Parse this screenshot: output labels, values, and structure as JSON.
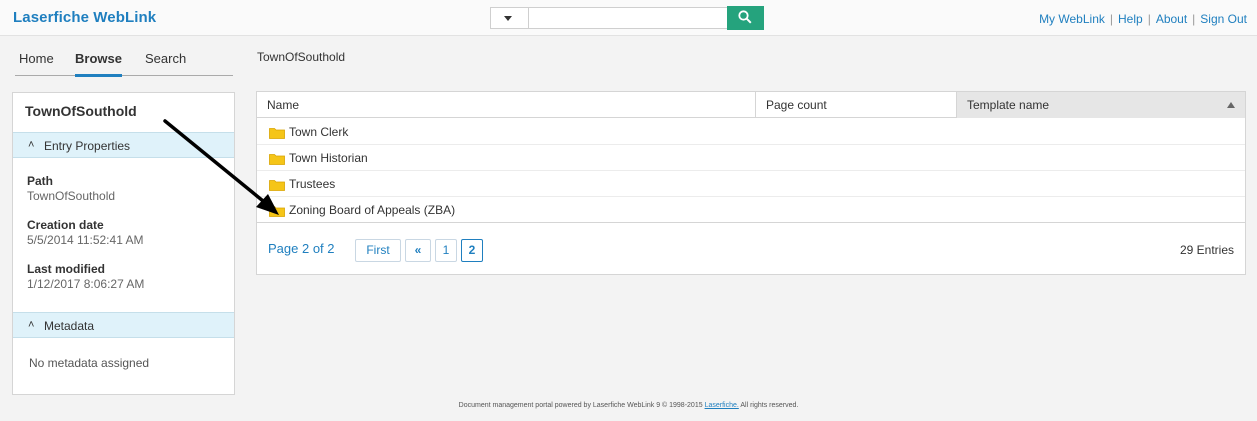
{
  "app": {
    "logo": "Laserfiche WebLink"
  },
  "search": {
    "value": "",
    "placeholder": ""
  },
  "toplinks": {
    "my_weblink": "My WebLink",
    "help": "Help",
    "about": "About",
    "sign_out": "Sign Out",
    "separator": "|"
  },
  "nav": {
    "tabs": [
      {
        "label": "Home"
      },
      {
        "label": "Browse"
      },
      {
        "label": "Search"
      }
    ],
    "active": "Browse"
  },
  "leftpanel": {
    "title": "TownOfSouthold",
    "entry_properties_label": "Entry Properties",
    "properties": [
      {
        "key": "Path",
        "value": "TownOfSouthold"
      },
      {
        "key": "Creation date",
        "value": "5/5/2014 11:52:41 AM"
      },
      {
        "key": "Last modified",
        "value": "1/12/2017 8:06:27 AM"
      }
    ],
    "metadata_label": "Metadata",
    "no_metadata": "No metadata assigned"
  },
  "breadcrumb": "TownOfSouthold",
  "grid": {
    "columns": [
      {
        "label": "Name"
      },
      {
        "label": "Page count"
      },
      {
        "label": "Template name",
        "sorted": "asc"
      }
    ],
    "rows": [
      {
        "name": "Town Clerk",
        "page_count": "",
        "template": ""
      },
      {
        "name": "Town Historian",
        "page_count": "",
        "template": ""
      },
      {
        "name": "Trustees",
        "page_count": "",
        "template": ""
      },
      {
        "name": "Zoning Board of Appeals (ZBA)",
        "page_count": "",
        "template": ""
      }
    ]
  },
  "pager": {
    "label": "Page 2 of 2",
    "first": "First",
    "prev": "«",
    "pages": [
      "1",
      "2"
    ],
    "current": "2",
    "entries": "29 Entries"
  },
  "footer": {
    "text_before": "Document management portal powered by Laserfiche WebLink 9 © 1998-2015",
    "link": "Laserfiche.",
    "text_after": "All rights reserved."
  },
  "colors": {
    "brand": "#1f7fbf",
    "search_button": "#25a37d",
    "section_header": "#dff2fa",
    "folder": "#f5c518"
  },
  "icons": [
    "chevron-down-icon",
    "search-icon",
    "double-chevron-up-icon",
    "folder-icon",
    "sort-ascending-icon",
    "annotation-arrow"
  ]
}
